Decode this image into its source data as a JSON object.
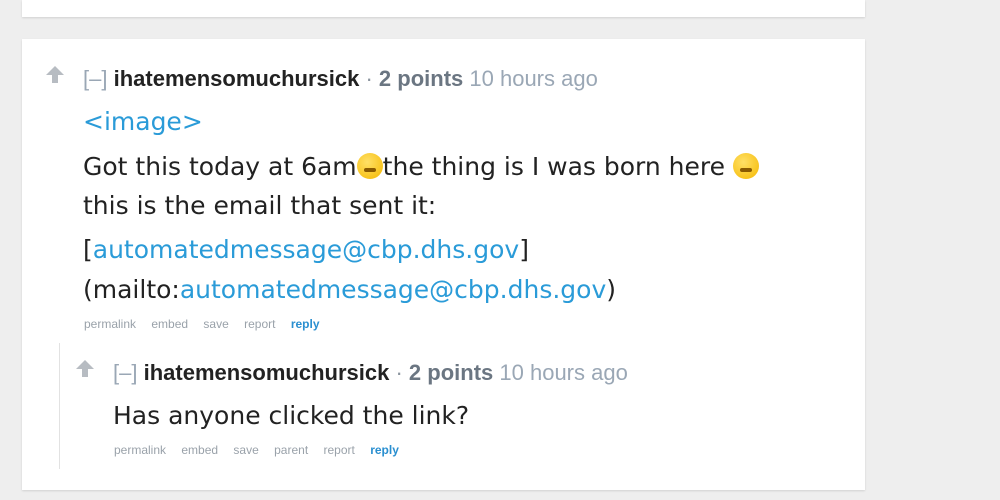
{
  "comment": {
    "toggle": "[–]",
    "author": "ihatemensomuchursick",
    "separator": "·",
    "points": "2 points",
    "time": "10 hours ago",
    "image_link": "<image>",
    "line1_a": "Got this today at 6am",
    "line1_emoji": "thinking-face-icon",
    "line1_b": "the thing is I was born here ",
    "line1_emoji2": "rolling-laughing-icon",
    "line2": "this is the email that sent it:",
    "bracket_open": "[",
    "email_link": "automatedmessage@cbp.dhs.gov",
    "bracket_close": "]",
    "mailto_prefix": "(mailto:",
    "mailto_link": "automatedmessage@cbp.dhs.gov",
    "mailto_suffix": ")",
    "actions": [
      "permalink",
      "embed",
      "save",
      "report"
    ],
    "reply": "reply"
  },
  "child": {
    "toggle": "[–]",
    "author": "ihatemensomuchursick",
    "separator": "·",
    "points": "2 points",
    "time": "10 hours ago",
    "body": "Has anyone clicked the link?",
    "actions": [
      "permalink",
      "embed",
      "save",
      "parent",
      "report"
    ],
    "reply": "reply"
  }
}
